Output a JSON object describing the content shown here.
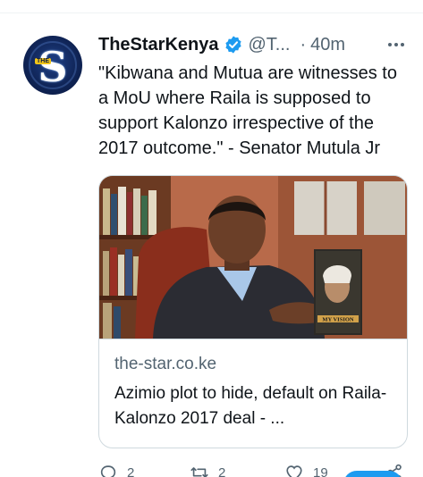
{
  "tweet": {
    "author_name": "TheStarKenya",
    "handle": "@T...",
    "separator": "·",
    "time": "40m",
    "text": "\"Kibwana and Mutua are witnesses to a MoU where Raila is supposed to support Kalonzo irrespective of the 2017 outcome.\" - Senator Mutula Jr",
    "avatar_letter": "S",
    "avatar_tag": "THE"
  },
  "card": {
    "domain": "the-star.co.ke",
    "title": "Azimio plot to hide, default on Raila-Kalonzo 2017 deal - ...",
    "book_caption": "MY VISION"
  },
  "actions": {
    "replies": "2",
    "retweets": "2",
    "likes": "19"
  },
  "colors": {
    "accent": "#1d9bf0",
    "secondary_text": "#536471",
    "border": "#cfd9de"
  },
  "icons": [
    "verified-badge-icon",
    "more-options-icon",
    "reply-icon",
    "retweet-icon",
    "like-icon",
    "share-icon"
  ]
}
